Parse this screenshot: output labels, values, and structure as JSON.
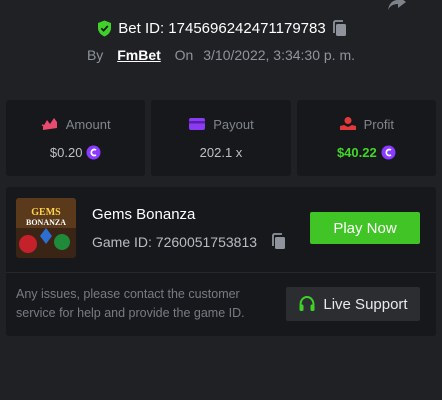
{
  "bet": {
    "id_text": "Bet ID: 1745696242471179783",
    "by_label": "By",
    "username": "FmBet",
    "on_label": "On",
    "date": "3/10/2022, 3:34:30 p. m."
  },
  "stats": [
    {
      "label": "Amount",
      "value": "$0.20",
      "icon": "money-wings-icon",
      "coin": true
    },
    {
      "label": "Payout",
      "value": "202.1 x",
      "icon": "card-icon",
      "coin": false
    },
    {
      "label": "Profit",
      "value": "$40.22",
      "icon": "hand-coin-icon",
      "coin": true
    }
  ],
  "game": {
    "title": "Gems Bonanza",
    "id_text": "Game ID: 7260051753813",
    "thumb_text_1": "GEMS",
    "thumb_text_2": "BONANZA",
    "play_label": "Play Now"
  },
  "support": {
    "message": "Any issues, please contact the customer service for help and provide the game ID.",
    "button_label": "Live Support"
  },
  "colors": {
    "background": "#1f2124",
    "panel": "#17181b",
    "green": "#41c425",
    "coin": "#8a3bff"
  }
}
